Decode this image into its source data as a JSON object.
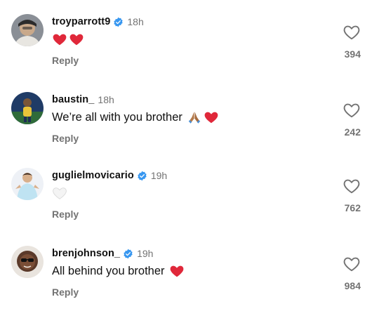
{
  "comments": [
    {
      "username": "troyparrott9",
      "verified": true,
      "time": "18h",
      "text": "",
      "emojis": [
        "red-heart",
        "red-heart"
      ],
      "reply_label": "Reply",
      "likes": "394"
    },
    {
      "username": "baustin_",
      "verified": false,
      "time": "18h",
      "text": "We’re all with you brother",
      "emojis": [
        "folded-hands",
        "red-heart"
      ],
      "reply_label": "Reply",
      "likes": "242"
    },
    {
      "username": "guglielmovicario",
      "verified": true,
      "time": "19h",
      "text": "",
      "emojis": [
        "white-heart"
      ],
      "reply_label": "Reply",
      "likes": "762"
    },
    {
      "username": "brenjohnson_",
      "verified": true,
      "time": "19h",
      "text": "All behind you brother",
      "emojis": [
        "red-heart"
      ],
      "reply_label": "Reply",
      "likes": "984"
    }
  ],
  "colors": {
    "verified": "#3897F0",
    "muted": "#737373",
    "text": "#111111",
    "red_heart": "#E0283A"
  }
}
